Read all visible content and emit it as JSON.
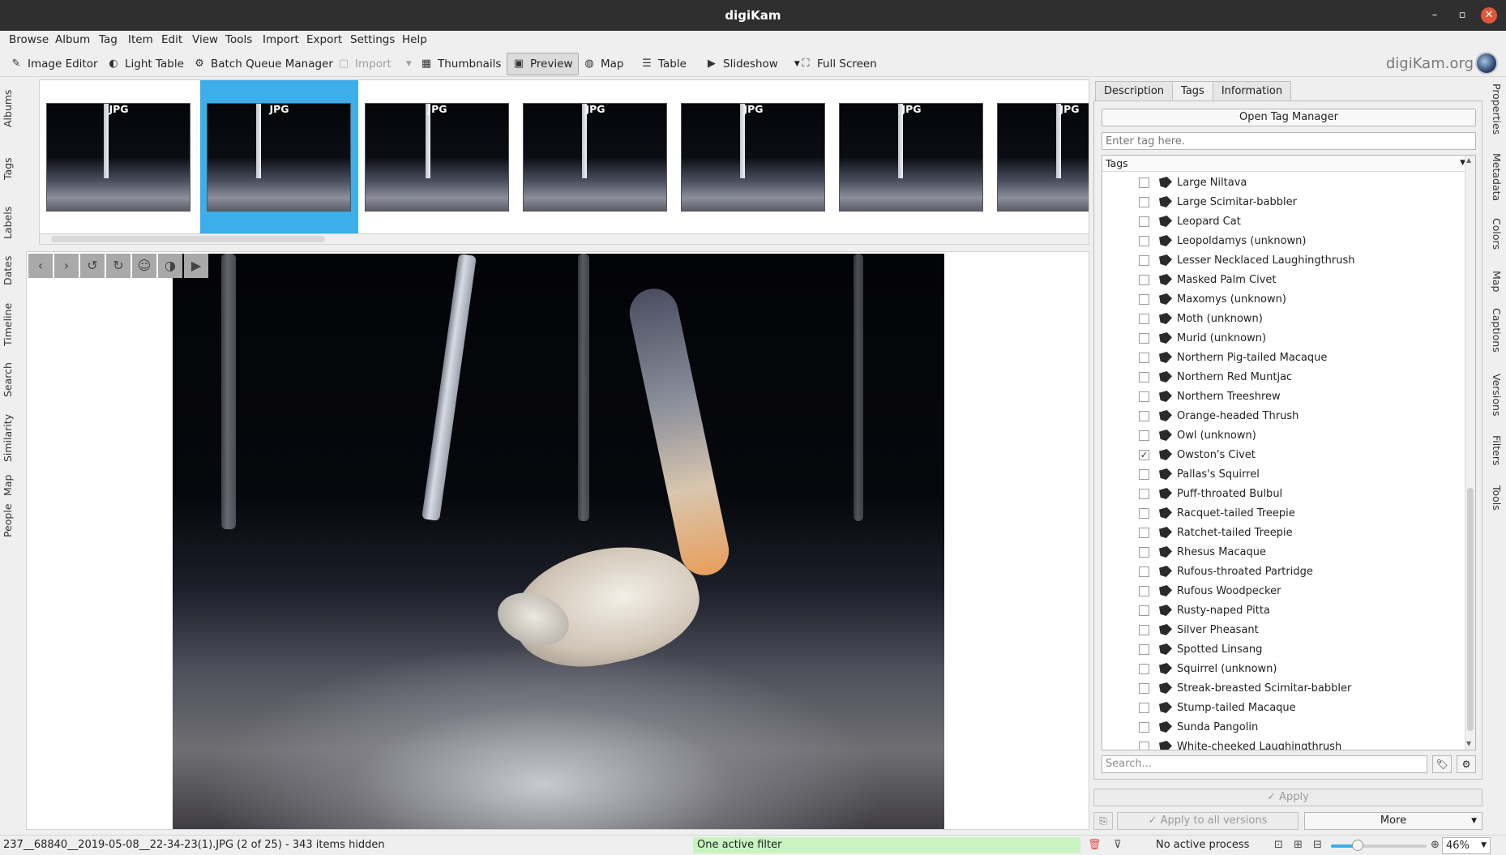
{
  "window": {
    "title": "digiKam"
  },
  "menu": [
    "Browse",
    "Album",
    "Tag",
    "Item",
    "Edit",
    "View",
    "Tools",
    "Import",
    "Export",
    "Settings",
    "Help"
  ],
  "toolbar": {
    "image_editor": "Image Editor",
    "light_table": "Light Table",
    "batch_queue": "Batch Queue Manager",
    "import": "Import",
    "thumbnails": "Thumbnails",
    "preview": "Preview",
    "map": "Map",
    "table": "Table",
    "slideshow": "Slideshow",
    "full_screen": "Full Screen",
    "brand": "digiKam.org"
  },
  "left_tabs": [
    "Albums",
    "Tags",
    "Labels",
    "Dates",
    "Timeline",
    "Search",
    "Similarity",
    "Map",
    "People"
  ],
  "right_tabs": [
    "Properties",
    "Metadata",
    "Colors",
    "Map",
    "Captions",
    "Versions",
    "Filters",
    "Tools"
  ],
  "thumbnails": [
    {
      "label": "JPG",
      "selected": false
    },
    {
      "label": "JPG",
      "selected": true
    },
    {
      "label": "JPG",
      "selected": false
    },
    {
      "label": "JPG",
      "selected": false
    },
    {
      "label": "JPG",
      "selected": false
    },
    {
      "label": "JPG",
      "selected": false
    },
    {
      "label": "JPG",
      "selected": false
    }
  ],
  "panel": {
    "tabs": [
      "Description",
      "Tags",
      "Information"
    ],
    "active_tab": "Tags",
    "open_tag_manager": "Open Tag Manager",
    "tag_entry_placeholder": "Enter tag here.",
    "tree_header": "Tags",
    "search_placeholder": "Search...",
    "apply": "Apply",
    "apply_all": "Apply to all versions",
    "more": "More"
  },
  "tags": [
    {
      "name": "Large Niltava",
      "checked": false
    },
    {
      "name": "Large Scimitar-babbler",
      "checked": false
    },
    {
      "name": "Leopard Cat",
      "checked": false
    },
    {
      "name": "Leopoldamys (unknown)",
      "checked": false
    },
    {
      "name": "Lesser Necklaced Laughingthrush",
      "checked": false
    },
    {
      "name": "Masked Palm Civet",
      "checked": false
    },
    {
      "name": "Maxomys (unknown)",
      "checked": false
    },
    {
      "name": "Moth (unknown)",
      "checked": false
    },
    {
      "name": "Murid (unknown)",
      "checked": false
    },
    {
      "name": "Northern Pig-tailed Macaque",
      "checked": false
    },
    {
      "name": "Northern Red Muntjac",
      "checked": false
    },
    {
      "name": "Northern Treeshrew",
      "checked": false
    },
    {
      "name": "Orange-headed Thrush",
      "checked": false
    },
    {
      "name": "Owl (unknown)",
      "checked": false
    },
    {
      "name": "Owston's Civet",
      "checked": true
    },
    {
      "name": "Pallas's Squirrel",
      "checked": false
    },
    {
      "name": "Puff-throated Bulbul",
      "checked": false
    },
    {
      "name": "Racquet-tailed Treepie",
      "checked": false
    },
    {
      "name": "Ratchet-tailed Treepie",
      "checked": false
    },
    {
      "name": "Rhesus Macaque",
      "checked": false
    },
    {
      "name": "Rufous-throated Partridge",
      "checked": false
    },
    {
      "name": "Rufous Woodpecker",
      "checked": false
    },
    {
      "name": "Rusty-naped Pitta",
      "checked": false
    },
    {
      "name": "Silver Pheasant",
      "checked": false
    },
    {
      "name": "Spotted Linsang",
      "checked": false
    },
    {
      "name": "Squirrel (unknown)",
      "checked": false
    },
    {
      "name": "Streak-breasted Scimitar-babbler",
      "checked": false
    },
    {
      "name": "Stump-tailed Macaque",
      "checked": false
    },
    {
      "name": "Sunda Pangolin",
      "checked": false
    },
    {
      "name": "White-cheeked Laughingthrush",
      "checked": false
    }
  ],
  "status": {
    "file": "237__68840__2019-05-08__22-34-23(1).JPG (2 of 25) - 343 items hidden",
    "filter": "One active filter",
    "process": "No active process",
    "zoom": "46%",
    "zoom_fraction": 0.46
  },
  "colors": {
    "accent": "#3daee9",
    "filter_bg": "#c9f4c1",
    "titlebar": "#2f2f2f"
  }
}
